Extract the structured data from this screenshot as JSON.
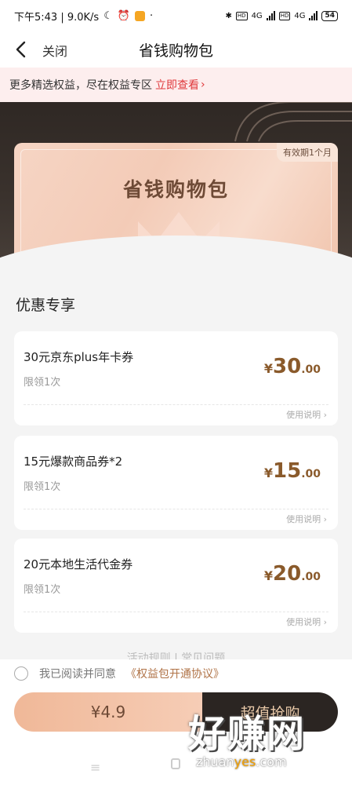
{
  "status_bar": {
    "time_speed": "下午5:43 | 9.0K/s",
    "network_1": "4G",
    "network_2": "4G",
    "hd_1": "HD",
    "hd_2": "HD",
    "battery": "54"
  },
  "nav": {
    "close_label": "关闭",
    "title": "省钱购物包"
  },
  "promo": {
    "text": "更多精选权益，尽在权益专区",
    "link": "立即查看"
  },
  "hero": {
    "validity_badge": "有效期1个月",
    "card_title": "省钱购物包"
  },
  "section": {
    "title": "优惠专享"
  },
  "coupons": [
    {
      "name": "30元京东plus年卡券",
      "limit": "限领1次",
      "currency": "¥",
      "price_int": "30",
      "price_dec": ".00",
      "help": "使用说明"
    },
    {
      "name": "15元爆款商品券*2",
      "limit": "限领1次",
      "currency": "¥",
      "price_int": "15",
      "price_dec": ".00",
      "help": "使用说明"
    },
    {
      "name": "20元本地生活代金券",
      "limit": "限领1次",
      "currency": "¥",
      "price_int": "20",
      "price_dec": ".00",
      "help": "使用说明"
    }
  ],
  "bottom": {
    "peek_text": "活动规则 | 常见问题",
    "agree_text": "我已阅读并同意",
    "agreement_link": "《权益包开通协议》",
    "price": "¥4.9",
    "buy_label": "超值抢购"
  },
  "watermark": {
    "big": "好赚网",
    "url_pre": "zhuan",
    "url_yes": "yes",
    "url_post": ".com"
  },
  "colors": {
    "accent_red": "#e0393c",
    "price_brown": "#8a5a2b",
    "buy_dark": "#2b2522",
    "card_peach": "#f3cbb7"
  }
}
